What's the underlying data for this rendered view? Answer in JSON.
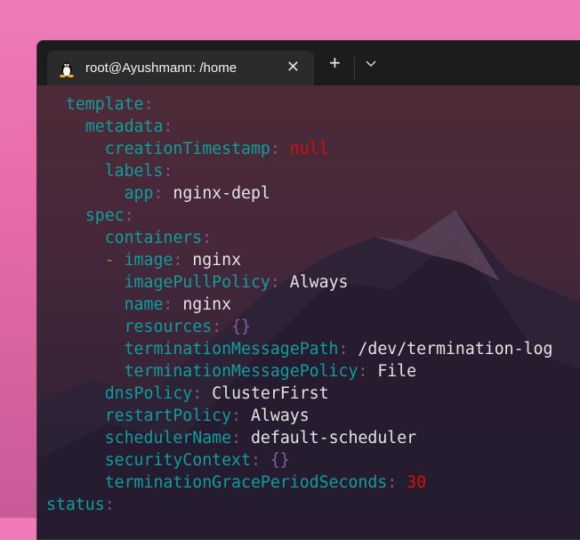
{
  "tab": {
    "title": "root@Ayushmann: /home",
    "icon": "tux-icon"
  },
  "colors": {
    "key": "#0f9e9e",
    "colon": "#7d5a86",
    "number": "#d40f0f",
    "brace": "#8a5aa5"
  },
  "lines": [
    {
      "indent": 2,
      "parts": [
        [
          "k",
          "template"
        ],
        [
          "c",
          ":"
        ]
      ]
    },
    {
      "indent": 4,
      "parts": [
        [
          "k",
          "metadata"
        ],
        [
          "c",
          ":"
        ]
      ]
    },
    {
      "indent": 6,
      "parts": [
        [
          "k",
          "creationTimestamp"
        ],
        [
          "c",
          ": "
        ],
        [
          "r",
          "null"
        ]
      ]
    },
    {
      "indent": 6,
      "parts": [
        [
          "k",
          "labels"
        ],
        [
          "c",
          ":"
        ]
      ]
    },
    {
      "indent": 8,
      "parts": [
        [
          "k",
          "app"
        ],
        [
          "c",
          ": "
        ],
        [
          "v",
          "nginx-depl"
        ]
      ]
    },
    {
      "indent": 4,
      "parts": [
        [
          "k",
          "spec"
        ],
        [
          "c",
          ":"
        ]
      ]
    },
    {
      "indent": 6,
      "parts": [
        [
          "k",
          "containers"
        ],
        [
          "c",
          ":"
        ]
      ]
    },
    {
      "indent": 6,
      "parts": [
        [
          "d",
          "- "
        ],
        [
          "k",
          "image"
        ],
        [
          "c",
          ": "
        ],
        [
          "v",
          "nginx"
        ]
      ]
    },
    {
      "indent": 8,
      "parts": [
        [
          "k",
          "imagePullPolicy"
        ],
        [
          "c",
          ": "
        ],
        [
          "v",
          "Always"
        ]
      ]
    },
    {
      "indent": 8,
      "parts": [
        [
          "k",
          "name"
        ],
        [
          "c",
          ": "
        ],
        [
          "v",
          "nginx"
        ]
      ]
    },
    {
      "indent": 8,
      "parts": [
        [
          "k",
          "resources"
        ],
        [
          "c",
          ": "
        ],
        [
          "b",
          "{}"
        ]
      ]
    },
    {
      "indent": 8,
      "parts": [
        [
          "k",
          "terminationMessagePath"
        ],
        [
          "c",
          ": "
        ],
        [
          "v",
          "/dev/termination-log"
        ]
      ]
    },
    {
      "indent": 8,
      "parts": [
        [
          "k",
          "terminationMessagePolicy"
        ],
        [
          "c",
          ": "
        ],
        [
          "v",
          "File"
        ]
      ]
    },
    {
      "indent": 6,
      "parts": [
        [
          "k",
          "dnsPolicy"
        ],
        [
          "c",
          ": "
        ],
        [
          "v",
          "ClusterFirst"
        ]
      ]
    },
    {
      "indent": 6,
      "parts": [
        [
          "k",
          "restartPolicy"
        ],
        [
          "c",
          ": "
        ],
        [
          "v",
          "Always"
        ]
      ]
    },
    {
      "indent": 6,
      "parts": [
        [
          "k",
          "schedulerName"
        ],
        [
          "c",
          ": "
        ],
        [
          "v",
          "default-scheduler"
        ]
      ]
    },
    {
      "indent": 6,
      "parts": [
        [
          "k",
          "securityContext"
        ],
        [
          "c",
          ": "
        ],
        [
          "b",
          "{}"
        ]
      ]
    },
    {
      "indent": 6,
      "parts": [
        [
          "k",
          "terminationGracePeriodSeconds"
        ],
        [
          "c",
          ": "
        ],
        [
          "r",
          "30"
        ]
      ]
    },
    {
      "indent": 0,
      "parts": [
        [
          "k",
          "status"
        ],
        [
          "c",
          ":"
        ]
      ]
    }
  ]
}
